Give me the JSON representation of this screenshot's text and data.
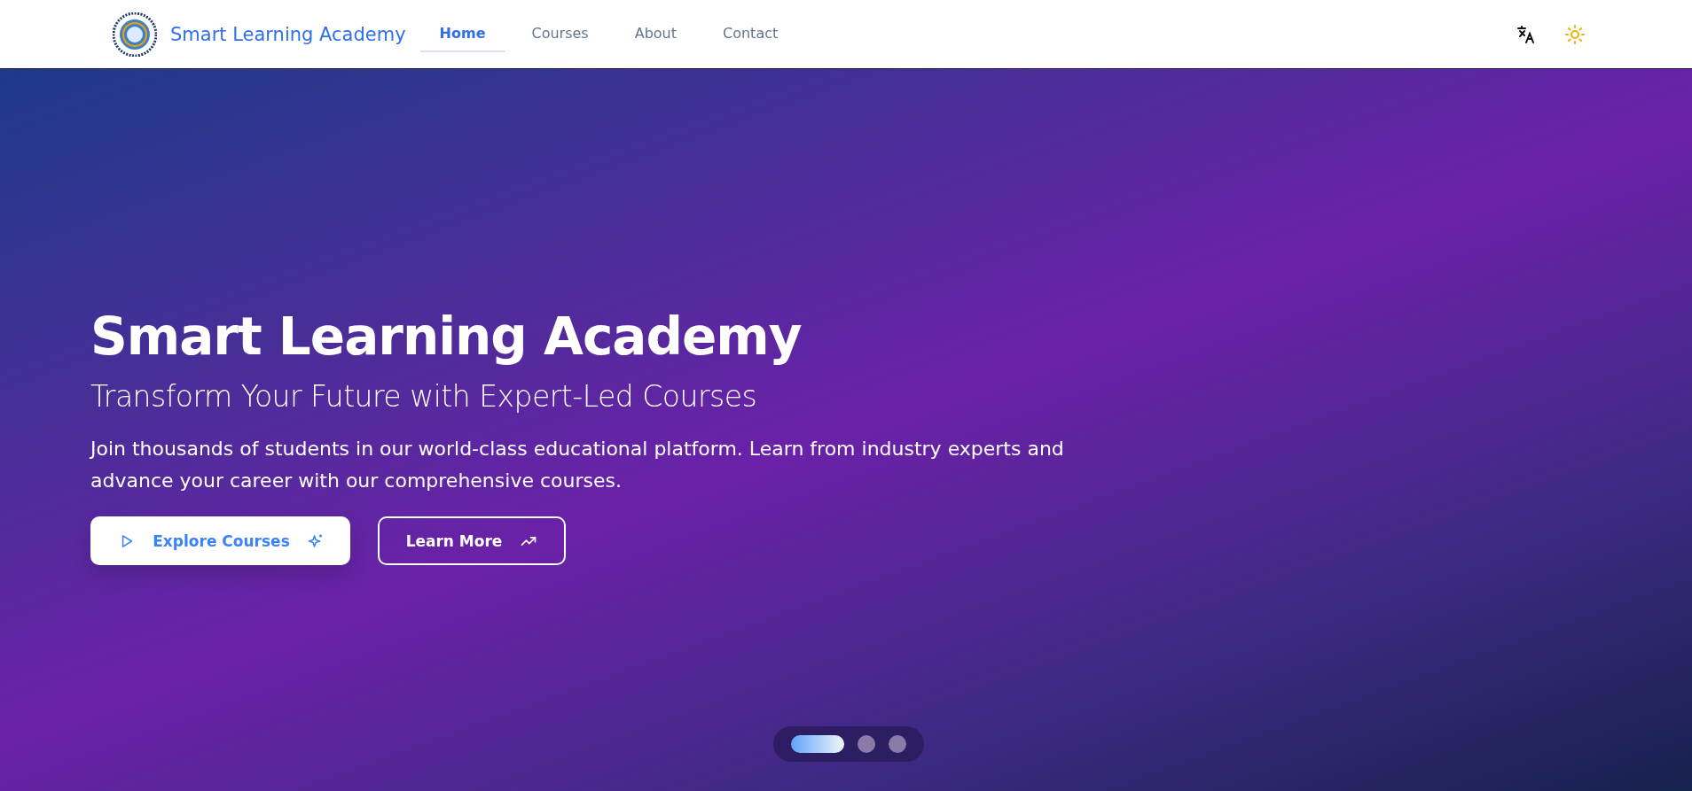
{
  "navbar": {
    "brand": "Smart Learning Academy",
    "links": [
      {
        "label": "Home",
        "selected": true
      },
      {
        "label": "Courses",
        "selected": false
      },
      {
        "label": "About",
        "selected": false
      },
      {
        "label": "Contact",
        "selected": false
      }
    ]
  },
  "hero": {
    "title": "Smart Learning Academy",
    "subtitle": "Transform Your Future with Expert-Led Courses",
    "description": "Join thousands of students in our world-class educational platform. Learn from industry experts and advance your career with our comprehensive courses.",
    "buttons": [
      {
        "label": "Explore Courses",
        "kind": "primary"
      },
      {
        "label": "Learn More",
        "kind": "outline"
      }
    ],
    "slides": [
      {
        "selected": true
      },
      {
        "selected": false
      },
      {
        "selected": false
      }
    ]
  }
}
